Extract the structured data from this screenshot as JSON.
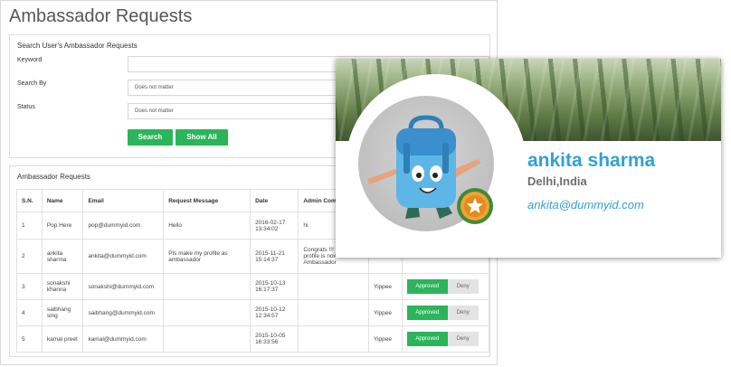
{
  "page": {
    "title": "Ambassador Requests"
  },
  "search": {
    "heading": "Search User's Ambassador Requests",
    "keyword_label": "Keyword",
    "keyword_value": "",
    "search_by_label": "Search By",
    "search_by_value": "Does not matter",
    "status_label": "Status",
    "status_value": "Does not matter",
    "search_button": "Search",
    "show_all_button": "Show All"
  },
  "requests": {
    "heading": "Ambassador Requests",
    "columns": [
      "S.N.",
      "Name",
      "Email",
      "Request Message",
      "Date",
      "Admin Comme"
    ],
    "rows": [
      {
        "sn": "1",
        "name": "Pop Here",
        "email": "pop@dummyid.com",
        "message": "Hello",
        "date": "2016-02-17 13:34:02",
        "comment": "hi",
        "reply": "",
        "approve": "",
        "deny": ""
      },
      {
        "sn": "2",
        "name": "ankita sharma",
        "email": "ankita@dummyid.com",
        "message": "Pls make my profile as ambassador",
        "date": "2015-11-21 15:14:37",
        "comment": "Congrats !!! your profile is now Ambassador",
        "reply": "",
        "approve": "",
        "deny": ""
      },
      {
        "sn": "3",
        "name": "sonakshi khanna",
        "email": "sonakshi@dummyid.com",
        "message": "",
        "date": "2015-10-13 16:17:37",
        "comment": "",
        "reply": "Yippee",
        "approve": "Approved",
        "deny": "Deny"
      },
      {
        "sn": "4",
        "name": "saibhang sing",
        "email": "saibhang@dummyid.com",
        "message": "",
        "date": "2015-10-12 12:34:57",
        "comment": "",
        "reply": "Yippee",
        "approve": "Approved",
        "deny": "Deny"
      },
      {
        "sn": "5",
        "name": "kamal preet",
        "email": "kamal@dummyid.com",
        "message": "",
        "date": "2015-10-05 16:33:56",
        "comment": "",
        "reply": "Yippee",
        "approve": "Approved",
        "deny": "Deny"
      }
    ]
  },
  "profile": {
    "name": "ankita sharma",
    "location": "Delhi,India",
    "email": "ankita@dummyid.com",
    "avatar_icon": "backpack-mascot-icon",
    "badge_icon": "star-medal-icon"
  },
  "colors": {
    "accent_green": "#2bb45a",
    "profile_blue": "#32a1d4"
  }
}
